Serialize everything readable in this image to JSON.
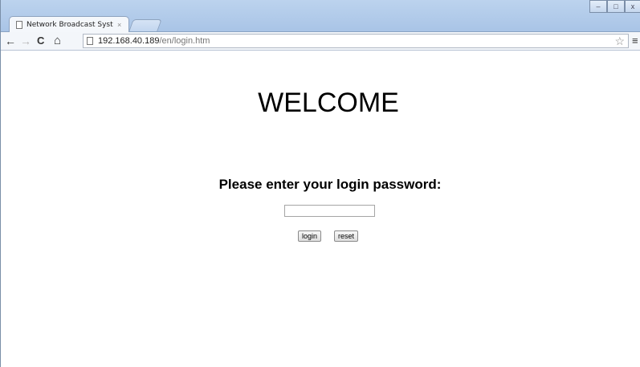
{
  "browser": {
    "tab": {
      "title": "Network Broadcast Syst",
      "close_glyph": "×"
    },
    "window_controls": {
      "minimize": "–",
      "maximize": "□",
      "close": "x"
    },
    "nav": {
      "back": "←",
      "forward": "→",
      "reload": "C",
      "home": "⌂"
    },
    "address": {
      "host": "192.168.40.189",
      "path": "/en/login.htm"
    },
    "star_glyph": "☆",
    "menu_glyph": "≡"
  },
  "page": {
    "heading": "WELCOME",
    "prompt": "Please enter your login password:",
    "password_field": {
      "value": "",
      "placeholder": ""
    },
    "buttons": {
      "login": "login",
      "reset": "reset"
    }
  },
  "icons": {
    "tab_page": "document-icon",
    "address_page": "page-icon",
    "bookmark": "star-icon",
    "menu": "hamburger-menu-icon"
  },
  "colors": {
    "frame": "#a9c4e6",
    "toolbar": "#f3f6fa",
    "page_background": "#ffffff",
    "text": "#000000"
  }
}
